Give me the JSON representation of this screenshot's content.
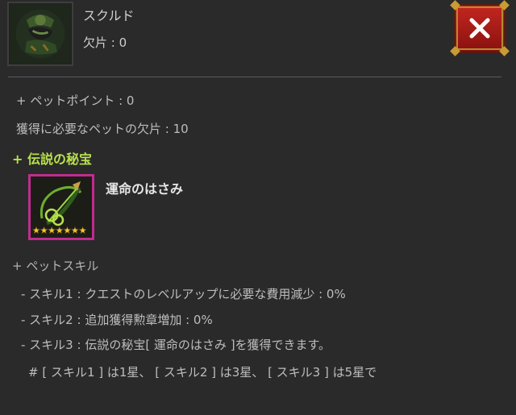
{
  "pet": {
    "name": "スクルド",
    "shards": "欠片 : 0",
    "icon": "pet-skuld-icon"
  },
  "close": {
    "icon": "close-x-icon",
    "color": "#c3261f"
  },
  "stats": {
    "pet_points": "+ ペットポイント : 0",
    "required_shards": "獲得に必要なペットの欠片 : 10"
  },
  "treasure": {
    "heading": "+ 伝説の秘宝",
    "name": "運命のはさみ",
    "icon": "fate-scissors-icon",
    "stars": 7,
    "border_color": "#c02c8e"
  },
  "skills": {
    "heading": "+ ペットスキル",
    "items": [
      "- スキル1 : クエストのレベルアップに必要な費用減少 : 0%",
      "- スキル2 : 追加獲得勲章増加 : 0%",
      "- スキル3 : 伝説の秘宝[ 運命のはさみ ]を獲得できます。"
    ],
    "note": "# [ スキル1 ] は1星、 [ スキル2 ] は3星、 [ スキル3 ] は5星で"
  },
  "colors": {
    "accent_green": "#b7e04b",
    "background": "#2a2a2a"
  }
}
